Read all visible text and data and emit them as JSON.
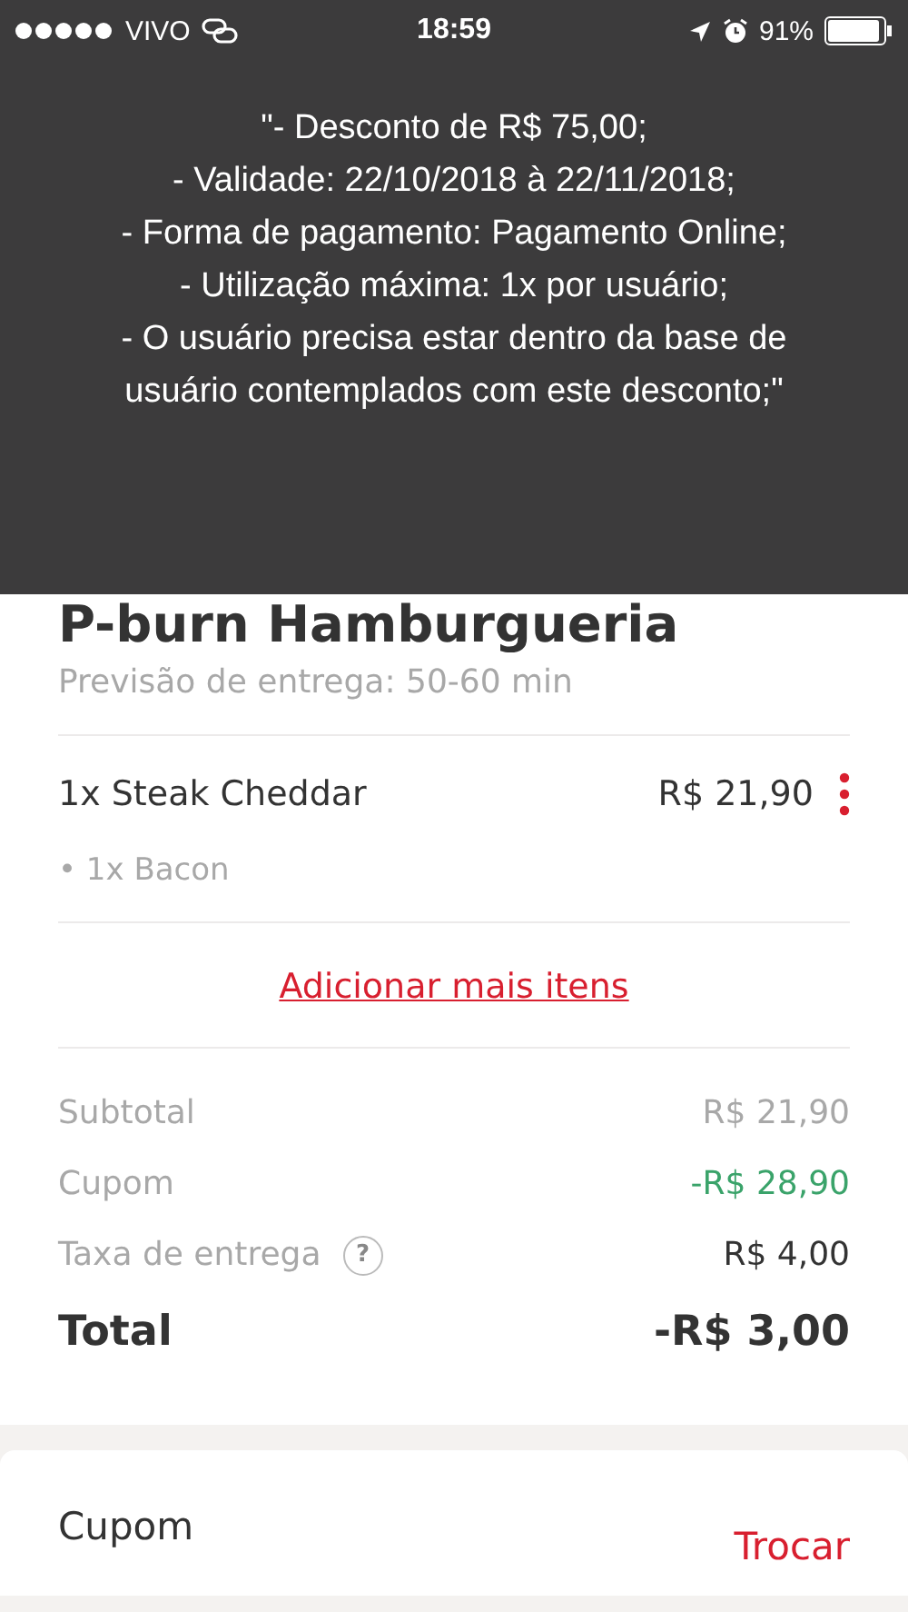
{
  "status_bar": {
    "carrier": "VIVO",
    "time": "18:59",
    "battery": "91%"
  },
  "tooltip": {
    "lines": [
      "\"- Desconto de R$ 75,00;",
      "- Validade: 22/10/2018 à 22/11/2018;",
      "- Forma de pagamento: Pagamento Online;",
      "- Utilização máxima: 1x por usuário;",
      "- O usuário precisa estar dentro da base de usuário contemplados com este desconto;\""
    ]
  },
  "restaurant": {
    "name": "P-burn Hamburgueria",
    "delivery_estimate": "Previsão de entrega: 50-60 min"
  },
  "items": [
    {
      "name": "1x Steak Cheddar",
      "price": "R$ 21,90",
      "extras": [
        "• 1x Bacon"
      ]
    }
  ],
  "add_more": "Adicionar mais itens",
  "summary": [
    {
      "kind": "plain",
      "label": "Subtotal",
      "value": "R$ 21,90"
    },
    {
      "kind": "discount",
      "label": "Cupom",
      "value": "-R$ 28,90"
    },
    {
      "kind": "fee",
      "label": "Taxa de entrega",
      "help": "?",
      "value": "R$ 4,00"
    },
    {
      "kind": "total",
      "label": "Total",
      "value": "-R$ 3,00"
    }
  ],
  "coupon_section": {
    "title": "Cupom",
    "action": "Trocar"
  }
}
